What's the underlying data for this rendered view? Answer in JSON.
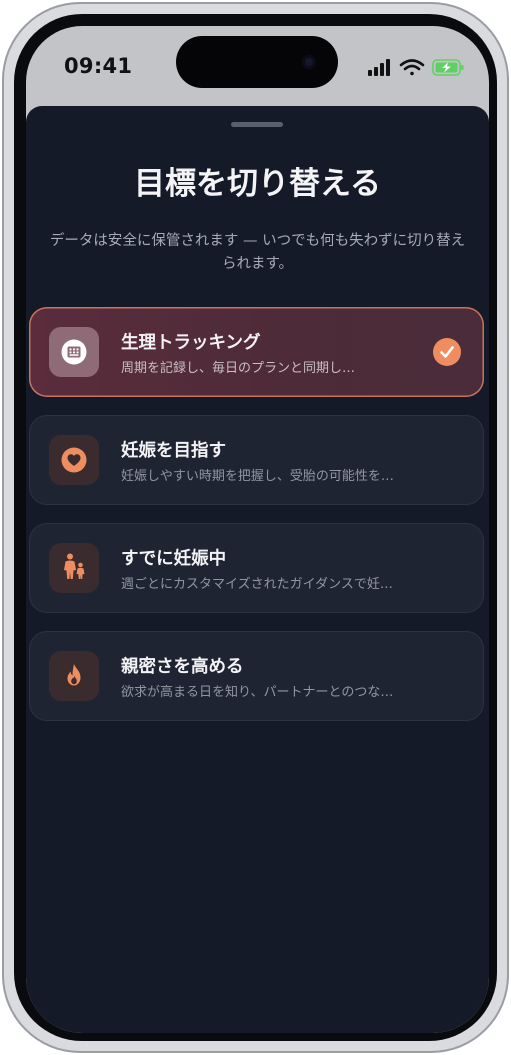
{
  "status_bar": {
    "time": "09:41",
    "icons": [
      "signal-icon",
      "wifi-icon",
      "battery-charging-icon"
    ],
    "battery_color": "#5fd163"
  },
  "sheet": {
    "title": "目標を切り替える",
    "subtitle": "データは安全に保管されます — いつでも何も失わずに切り替えられます。",
    "accent_color": "#ee8e60",
    "goals": [
      {
        "title": "生理トラッキング",
        "description": "周期を記録し、毎日のプランと同期し…",
        "icon": "calendar-icon",
        "selected": true
      },
      {
        "title": "妊娠を目指す",
        "description": "妊娠しやすい時期を把握し、受胎の可能性を…",
        "icon": "heart-icon",
        "selected": false
      },
      {
        "title": "すでに妊娠中",
        "description": "週ごとにカスタマイズされたガイダンスで妊…",
        "icon": "parent-child-icon",
        "selected": false
      },
      {
        "title": "親密さを高める",
        "description": "欲求が高まる日を知り、パートナーとのつな…",
        "icon": "flame-icon",
        "selected": false
      }
    ]
  }
}
